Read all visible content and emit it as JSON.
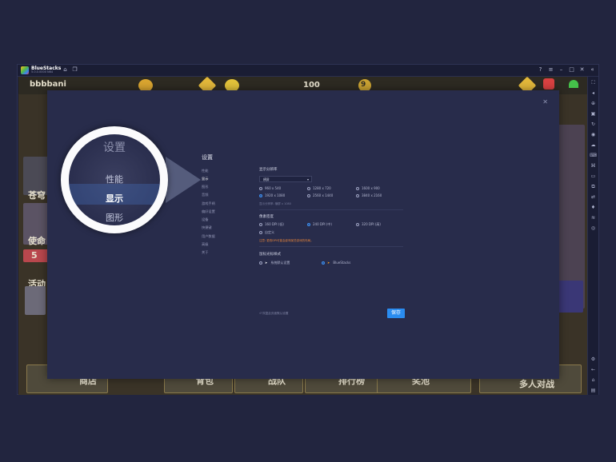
{
  "window": {
    "title": "BlueStacks",
    "version": "5.0.0.0000 N64"
  },
  "titlebar_icons": [
    "home-icon",
    "layers-icon",
    "help-icon",
    "menu-icon",
    "minimize-icon",
    "restore-icon",
    "close-icon",
    "collapse-icon"
  ],
  "game_texts": {
    "top_left": "bbbbani",
    "side_1": "苍穹",
    "side_2": "使命",
    "side_3": "活动",
    "side_4": "5",
    "btn_1": "商店",
    "btn_2": "背包",
    "btn_3": "战队",
    "btn_4": "排行榜",
    "btn_5": "奖池",
    "btn_6": "多人对战",
    "top_label_1": "100",
    "top_label_2": "9"
  },
  "magnifier": {
    "title": "设置",
    "items": [
      "性能",
      "显示",
      "图形"
    ],
    "active": "显示"
  },
  "settings": {
    "title": "设置",
    "nav": [
      "性能",
      "显示",
      "图形",
      "音频",
      "游戏手柄",
      "偏好设置",
      "设备",
      "快捷键",
      "用户数据",
      "高级",
      "关于"
    ],
    "active_nav": "显示",
    "resolution": {
      "label": "显示分辨率",
      "dropdown": "横屏",
      "options": [
        "960 x 540",
        "1280 x 720",
        "1600 x 900",
        "1920 x 1080",
        "2560 x 1440",
        "3840 x 2160"
      ],
      "selected": "1920 x 1080",
      "hint": "显示分辨率: 横屏 x 1080"
    },
    "dpi": {
      "label": "像素密度",
      "options": [
        "160 DPI (低)",
        "240 DPI (中)",
        "320 DPI (高)",
        "自定义"
      ],
      "selected": "240 DPI (中)",
      "warning": "注意: 更改DPI可能会影响某些游戏的布局。"
    },
    "cursor": {
      "label": "鼠标光标样式",
      "options": [
        "系统默认设置",
        "BlueStacks"
      ],
      "selected": "BlueStacks"
    },
    "restore": "恢复此页面默认设置",
    "save": "保存"
  },
  "colors": {
    "accent": "#2a8cf0",
    "background": "#22253f",
    "dialog": "#282c4b",
    "warning": "#e0803a"
  }
}
